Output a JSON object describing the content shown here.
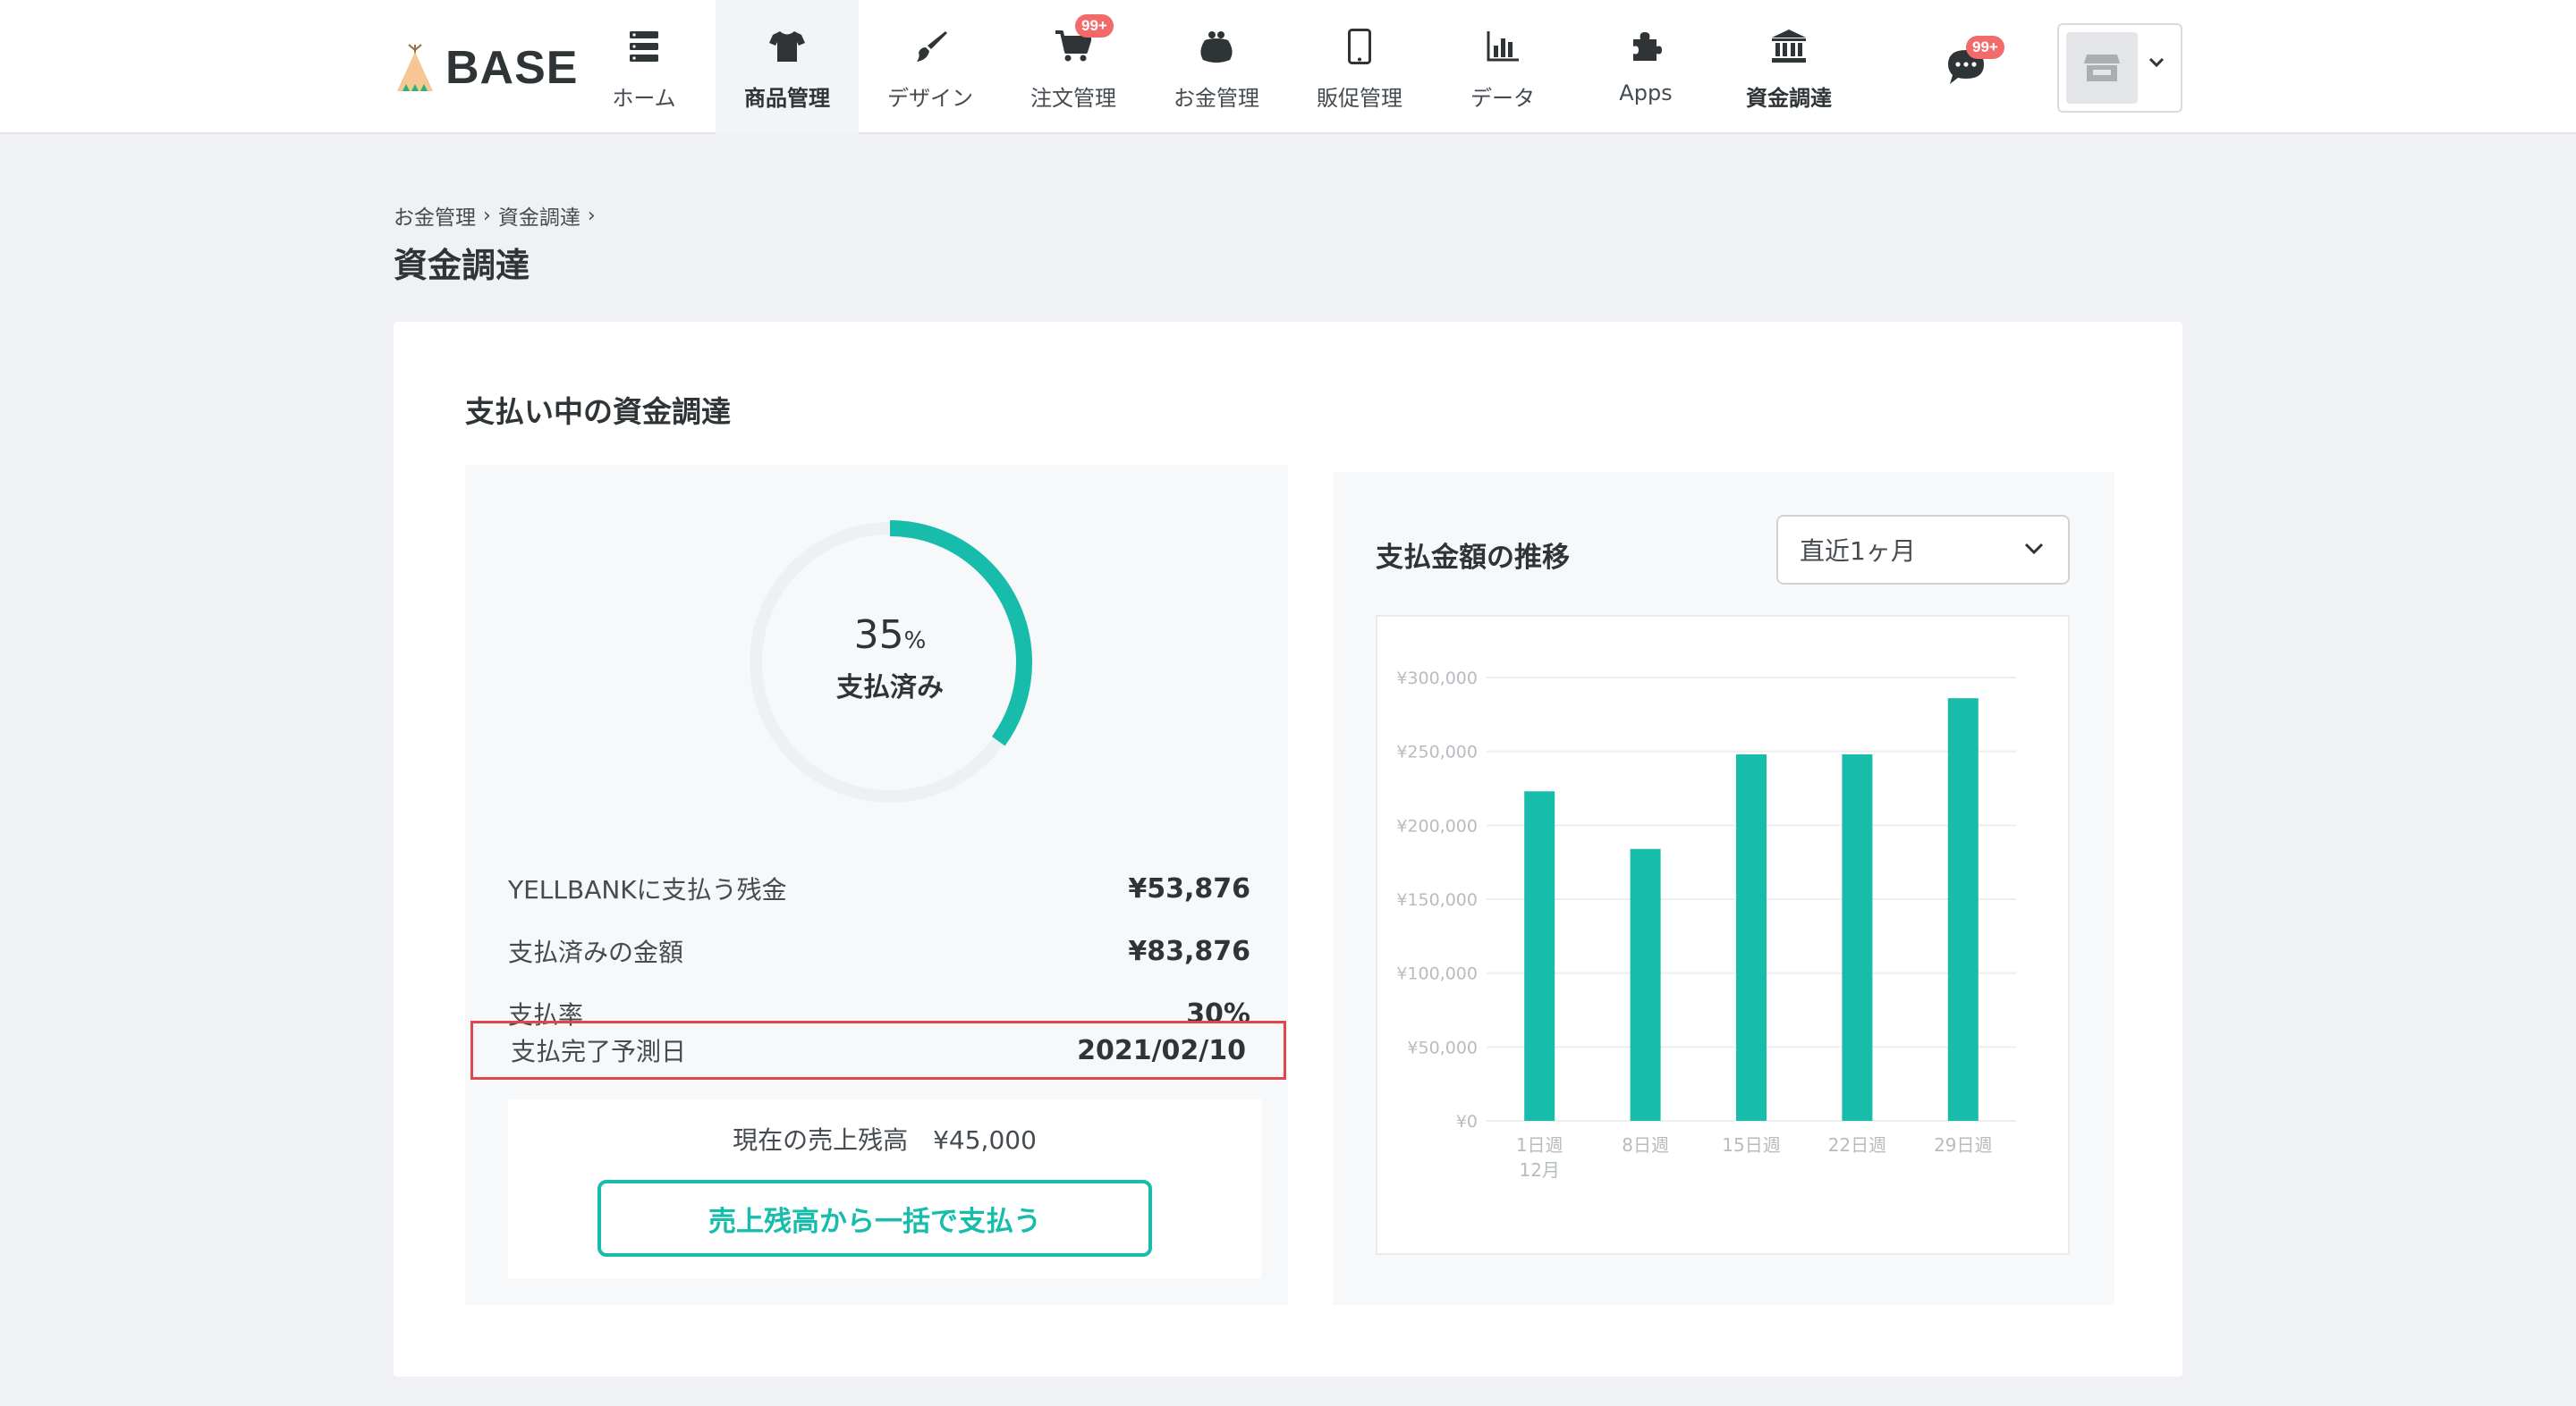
{
  "header": {
    "logo_text": "BASE",
    "nav": [
      {
        "label": "ホーム",
        "icon": "list-icon"
      },
      {
        "label": "商品管理",
        "icon": "tshirt-icon",
        "active": true
      },
      {
        "label": "デザイン",
        "icon": "brush-icon"
      },
      {
        "label": "注文管理",
        "icon": "cart-icon",
        "badge": "99+"
      },
      {
        "label": "お金管理",
        "icon": "wallet-icon"
      },
      {
        "label": "販促管理",
        "icon": "smartphone-icon"
      },
      {
        "label": "データ",
        "icon": "bar-chart-icon"
      },
      {
        "label": "Apps",
        "icon": "puzzle-icon"
      },
      {
        "label": "資金調達",
        "icon": "bank-icon",
        "bold": true
      }
    ],
    "chat_badge": "99+"
  },
  "breadcrumb": [
    "お金管理",
    "資金調達"
  ],
  "page_title": "資金調達",
  "section_title": "支払い中の資金調達",
  "gauge": {
    "percent": "35",
    "percent_unit": "%",
    "label": "支払済み",
    "value": 0.35,
    "color": "#17bcaa"
  },
  "summary": [
    {
      "label": "YELLBANKに支払う残金",
      "value": "¥53,876"
    },
    {
      "label": "支払済みの金額",
      "value": "¥83,876"
    },
    {
      "label": "支払率",
      "value": "30%"
    },
    {
      "label": "支払完了予測日",
      "value": "2021/02/10"
    }
  ],
  "balance_text": "現在の売上残高　¥45,000",
  "pay_button": "売上残高から一括で支払う",
  "chart_panel": {
    "title": "支払金額の推移",
    "period_select": "直近1ヶ月"
  },
  "chart_data": {
    "type": "bar",
    "title": "",
    "xlabel": "",
    "ylabel": "",
    "categories": [
      "1日週",
      "8日週",
      "15日週",
      "22日週",
      "29日週"
    ],
    "category_sublabels": [
      "12月",
      "",
      "",
      "",
      ""
    ],
    "values": [
      223000,
      184000,
      248000,
      248000,
      286000
    ],
    "ylim": [
      0,
      300000
    ],
    "yticks": [
      "¥0",
      "¥50,000",
      "¥100,000",
      "¥150,000",
      "¥200,000",
      "¥250,000",
      "¥300,000"
    ],
    "grid": true,
    "bar_color": "#17bcaa"
  },
  "colors": {
    "accent": "#17bcaa",
    "highlight_border": "#e0474c",
    "badge": "#f26a6a"
  }
}
